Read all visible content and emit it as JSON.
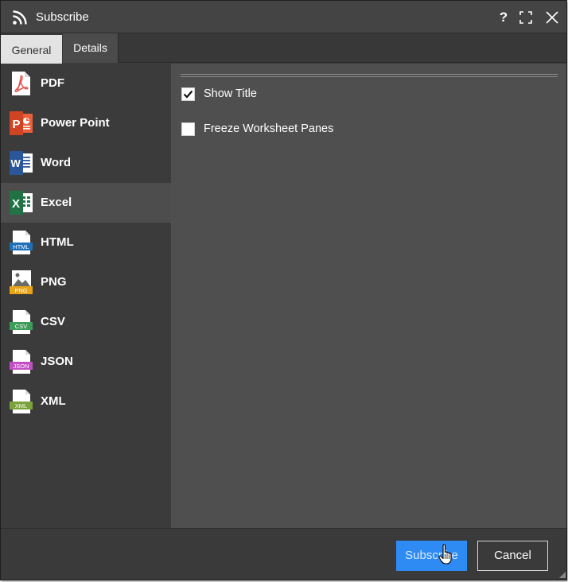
{
  "window": {
    "title": "Subscribe",
    "help_label": "?"
  },
  "tabs": [
    {
      "label": "General",
      "selected": true
    },
    {
      "label": "Details",
      "selected": false
    }
  ],
  "formats": [
    {
      "label": "PDF",
      "icon": "pdf-icon"
    },
    {
      "label": "Power Point",
      "icon": "powerpoint-icon"
    },
    {
      "label": "Word",
      "icon": "word-icon"
    },
    {
      "label": "Excel",
      "icon": "excel-icon",
      "selected": true
    },
    {
      "label": "HTML",
      "icon": "html-icon",
      "badge": "HTML"
    },
    {
      "label": "PNG",
      "icon": "png-icon",
      "badge": "PNG"
    },
    {
      "label": "CSV",
      "icon": "csv-icon",
      "badge": "CSV"
    },
    {
      "label": "JSON",
      "icon": "json-icon",
      "badge": "JSON"
    },
    {
      "label": "XML",
      "icon": "xml-icon",
      "badge": "XML"
    }
  ],
  "options": [
    {
      "label": "Show Title",
      "checked": true
    },
    {
      "label": "Freeze Worksheet Panes",
      "checked": false
    }
  ],
  "buttons": {
    "subscribe": "Subscribe",
    "cancel": "Cancel"
  },
  "colors": {
    "primary": "#2f8bf4",
    "pdf": "#e2574c",
    "powerpoint": "#d04423",
    "word": "#2b579a",
    "excel": "#217346",
    "html": "#1d6fb8",
    "png": "#e8a317",
    "csv": "#3f9d5a",
    "json": "#c44fc4",
    "xml": "#7aa23a"
  }
}
